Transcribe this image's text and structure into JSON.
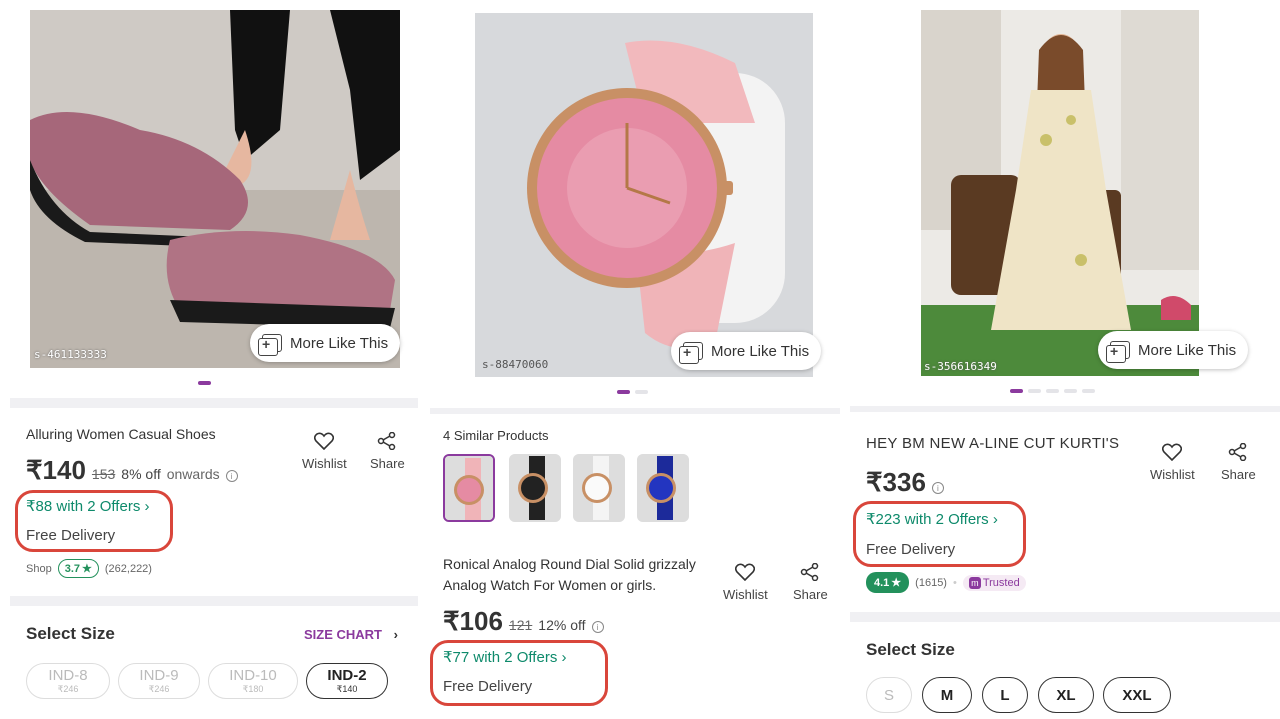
{
  "products": [
    {
      "image_code": "s-461133333",
      "more_like_this": "More Like This",
      "title": "Alluring Women Casual Shoes",
      "price": "₹140",
      "mrp": "153",
      "discount": "8% off",
      "onwards": "onwards",
      "offers": "₹88 with 2 Offers",
      "delivery": "Free Delivery",
      "shop_label": "Shop",
      "rating": "3.7",
      "rating_count": "(262,222)",
      "wishlist": "Wishlist",
      "share": "Share",
      "select_size": "Select Size",
      "size_chart": "SIZE CHART",
      "sizes": [
        {
          "label": "IND-8",
          "price": "₹246",
          "available": false
        },
        {
          "label": "IND-9",
          "price": "₹246",
          "available": false
        },
        {
          "label": "IND-10",
          "price": "₹180",
          "available": false
        },
        {
          "label": "IND-2",
          "price": "₹140",
          "available": true
        }
      ]
    },
    {
      "image_code": "s-88470060",
      "more_like_this": "More Like This",
      "similar_label": "4 Similar Products",
      "title": "Ronical Analog Round Dial Solid grizzaly Analog  Watch  For Women or girls.",
      "price": "₹106",
      "mrp": "121",
      "discount": "12% off",
      "offers": "₹77 with 2 Offers",
      "delivery": "Free Delivery",
      "wishlist": "Wishlist",
      "share": "Share"
    },
    {
      "image_code": "s-356616349",
      "more_like_this": "More Like This",
      "title": "HEY BM NEW A-LINE CUT KURTI'S",
      "price": "₹336",
      "offers": "₹223 with 2 Offers",
      "delivery": "Free Delivery",
      "rating": "4.1",
      "rating_count": "(1615)",
      "trusted": "Trusted",
      "wishlist": "Wishlist",
      "share": "Share",
      "select_size": "Select Size",
      "sizes": [
        {
          "label": "S",
          "available": false
        },
        {
          "label": "M",
          "available": true
        },
        {
          "label": "L",
          "available": true
        },
        {
          "label": "XL",
          "available": true
        },
        {
          "label": "XXL",
          "available": true
        }
      ]
    }
  ],
  "colors": {
    "brand": "#8b3a9e",
    "offer_green": "#0e8a6b",
    "highlight_red": "#d9463b",
    "rating_green": "#23915c"
  }
}
